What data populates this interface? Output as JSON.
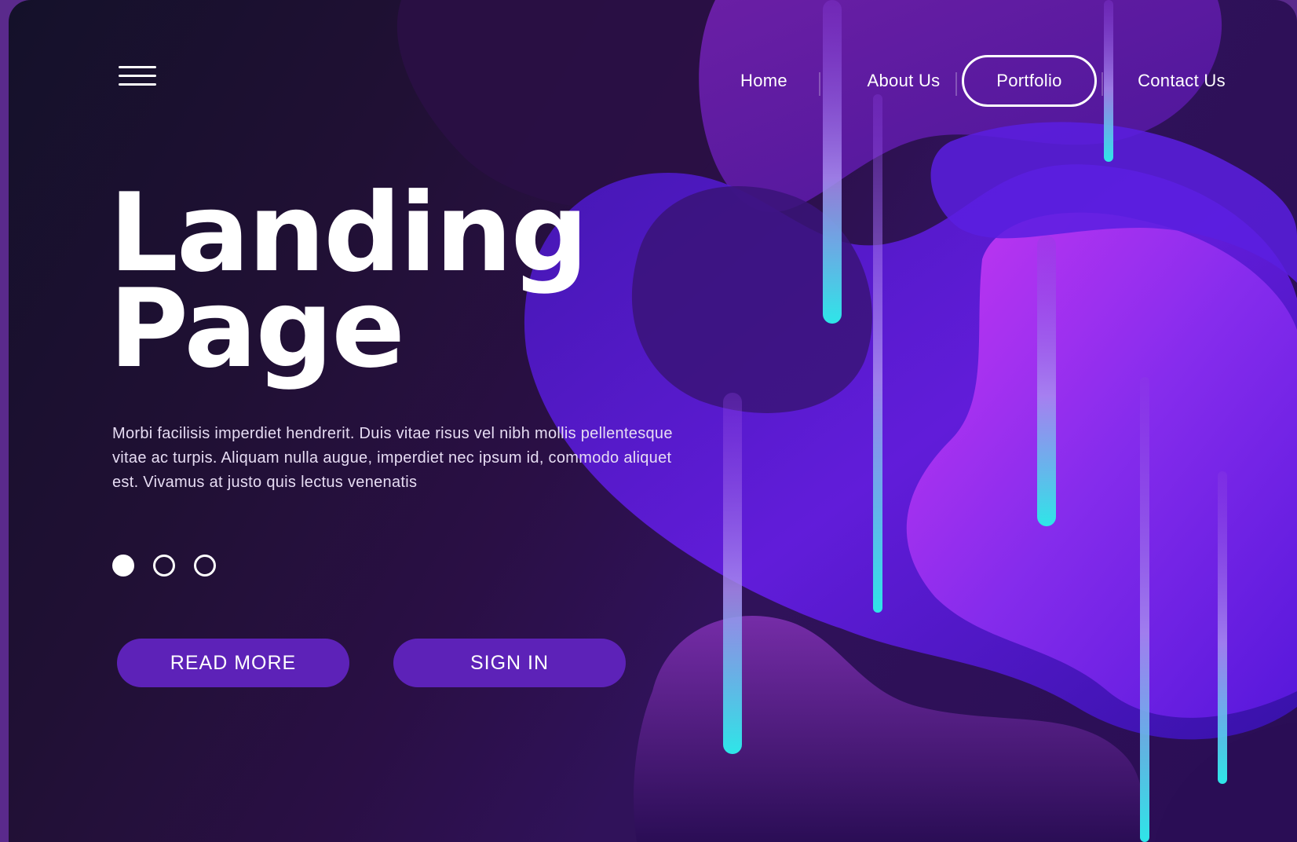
{
  "nav": {
    "items": [
      {
        "label": "Home",
        "active": false
      },
      {
        "label": "About Us",
        "active": false
      },
      {
        "label": "Portfolio",
        "active": true
      },
      {
        "label": "Contact Us",
        "active": false
      }
    ]
  },
  "menu": {
    "icon": "hamburger-menu-icon"
  },
  "hero": {
    "title_line1": "Landing",
    "title_line2": "Page",
    "body": "Morbi facilisis imperdiet hendrerit. Duis vitae risus vel nibh mollis pellentesque vitae ac turpis. Aliquam nulla augue, imperdiet nec ipsum id, commodo aliquet est. Vivamus at justo quis lectus venenatis"
  },
  "carousel": {
    "count": 3,
    "active_index": 0
  },
  "buttons": {
    "read_more": "READ MORE",
    "sign_in": "SIGN IN"
  },
  "colors": {
    "background_dark": "#1a1030",
    "accent_purple": "#5d22b8",
    "neon_cyan": "#2ee6e8",
    "magenta": "#c02df0"
  }
}
